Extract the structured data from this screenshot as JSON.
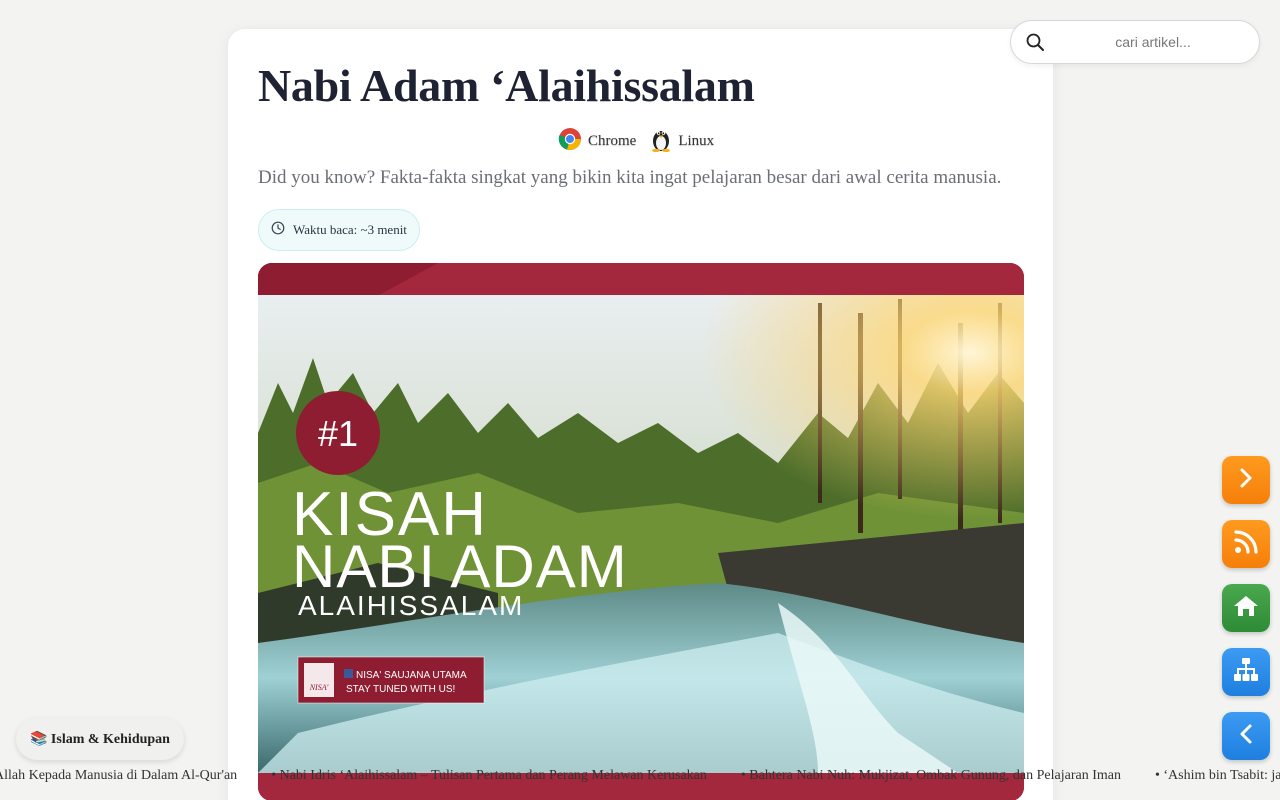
{
  "article": {
    "title": "Nabi Adam ‘Alaihissalam",
    "platforms": [
      {
        "label": "Chrome",
        "icon": "chrome-icon"
      },
      {
        "label": "Linux",
        "icon": "linux-tux-icon"
      }
    ],
    "subtitle": "Did you know? Fakta-fakta singkat yang bikin kita ingat pelajaran besar dari awal cerita manusia.",
    "reading_time": "Waktu baca: ~3 menit",
    "hero": {
      "number": "#1",
      "line1": "KISAH",
      "line2": "NABI ADAM",
      "line3": "ALAIHISSALAM",
      "brand_line1": "NISA' SAUJANA UTAMA",
      "brand_line2": "STAY TUNED WITH US!",
      "logo_text": "NISA'"
    }
  },
  "search": {
    "placeholder": "cari artikel..."
  },
  "side_buttons": [
    {
      "icon": "chevron-right-icon",
      "color": "#f78b14"
    },
    {
      "icon": "rss-icon",
      "color": "#f78b14"
    },
    {
      "icon": "home-icon",
      "color": "#3d9a43"
    },
    {
      "icon": "sitemap-icon",
      "color": "#2b8cea"
    },
    {
      "icon": "chevron-left-icon",
      "color": "#2b8cea"
    }
  ],
  "category": {
    "label": "📚 Islam & Kehidupan"
  },
  "ticker": [
    "Allah Kepada Manusia di Dalam Al-Qur'an",
    "• Nabi Idris ‘Alaihissalam – Tulisan Pertama dan Perang Melawan Kerusakan",
    "• Bahtera Nabi Nuh: Mukjizat, Ombak Gunung, dan Pelajaran Iman",
    "• ‘Ashim bin Tsabit: janji d"
  ],
  "colors": {
    "accent_maroon": "#a4283d",
    "fab_orange": "#f78b14",
    "fab_green": "#3d9a43",
    "fab_blue": "#2b8cea"
  }
}
